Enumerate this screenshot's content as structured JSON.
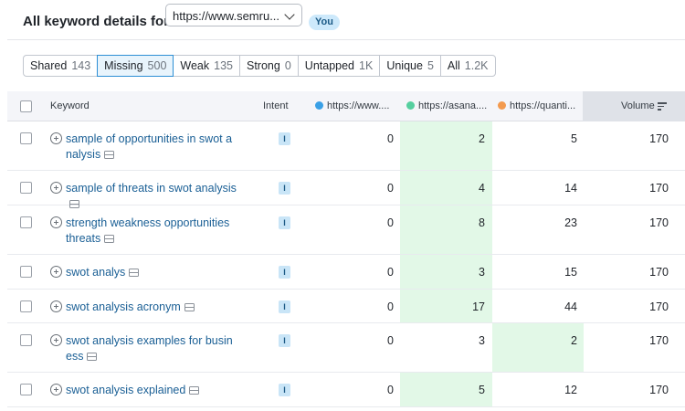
{
  "header": {
    "title": "All keyword details for:",
    "domain_selected": "https://www.semru...",
    "you_badge": "You"
  },
  "filters": [
    {
      "label": "Shared",
      "count": "143",
      "active": false
    },
    {
      "label": "Missing",
      "count": "500",
      "active": true
    },
    {
      "label": "Weak",
      "count": "135",
      "active": false
    },
    {
      "label": "Strong",
      "count": "0",
      "active": false
    },
    {
      "label": "Untapped",
      "count": "1K",
      "active": false
    },
    {
      "label": "Unique",
      "count": "5",
      "active": false
    },
    {
      "label": "All",
      "count": "1.2K",
      "active": false
    }
  ],
  "columns": {
    "keyword": "Keyword",
    "intent": "Intent",
    "domain1": "https://www....",
    "domain2": "https://asana....",
    "domain3": "https://quanti...",
    "volume": "Volume"
  },
  "colors": {
    "domain1": "#3aa0e6",
    "domain2": "#55cf9f",
    "domain3": "#f39a4e",
    "highlight": "#e2f8e7",
    "link": "#1a5f95"
  },
  "rows": [
    {
      "keyword": "sample of opportunities in swot a nalysis",
      "intent": "I",
      "d1": "0",
      "d2": "2",
      "d3": "5",
      "volume": "170",
      "best": 2
    },
    {
      "keyword": "sample of threats in swot analysis",
      "intent": "I",
      "d1": "0",
      "d2": "4",
      "d3": "14",
      "volume": "170",
      "best": 2
    },
    {
      "keyword": "strength weakness opportunities threats",
      "intent": "I",
      "d1": "0",
      "d2": "8",
      "d3": "23",
      "volume": "170",
      "best": 2
    },
    {
      "keyword": "swot analys",
      "intent": "I",
      "d1": "0",
      "d2": "3",
      "d3": "15",
      "volume": "170",
      "best": 2
    },
    {
      "keyword": "swot analysis acronym",
      "intent": "I",
      "d1": "0",
      "d2": "17",
      "d3": "44",
      "volume": "170",
      "best": 2
    },
    {
      "keyword": "swot analysis examples for busin ess",
      "intent": "I",
      "d1": "0",
      "d2": "3",
      "d3": "2",
      "volume": "170",
      "best": 3
    },
    {
      "keyword": "swot analysis explained",
      "intent": "I",
      "d1": "0",
      "d2": "5",
      "d3": "12",
      "volume": "170",
      "best": 2
    }
  ]
}
